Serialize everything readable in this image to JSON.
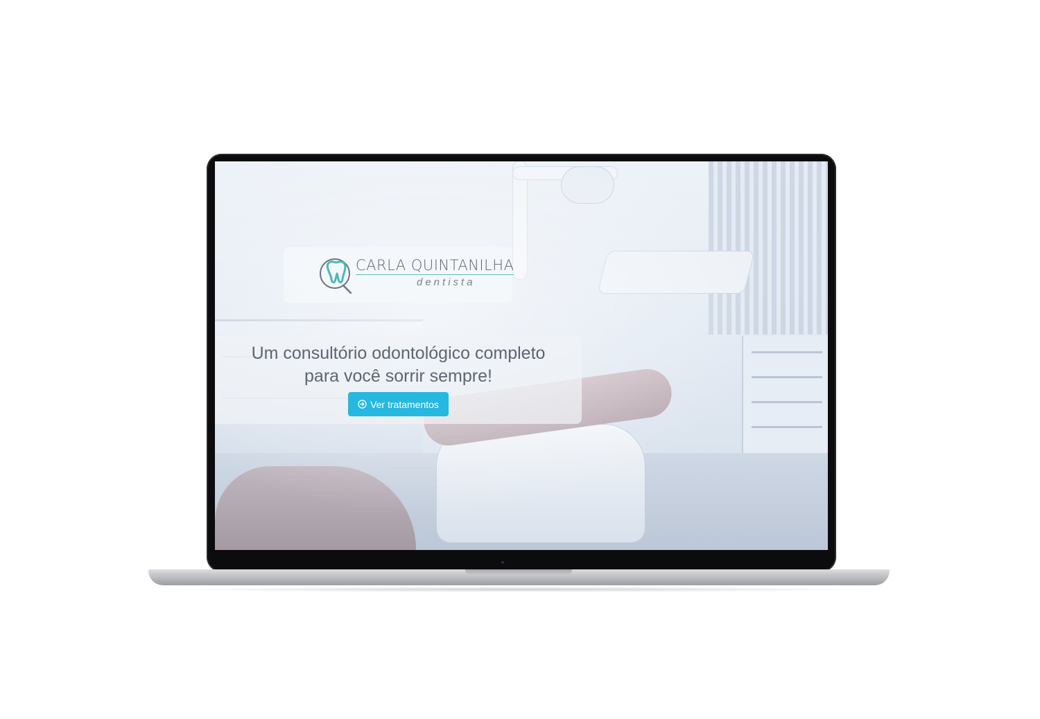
{
  "logo": {
    "name": "CARLA QUINTANILHA",
    "subtitle": "dentista",
    "accent_color": "#4db6c0"
  },
  "hero": {
    "headline_line1": "Um consultório odontológico completo",
    "headline_line2": "para você sorrir sempre!",
    "cta_label": "Ver tratamentos",
    "cta_icon": "arrow-circle-right-icon",
    "cta_color": "#26b8df"
  },
  "background": {
    "subject": "dental-clinic-photo"
  }
}
